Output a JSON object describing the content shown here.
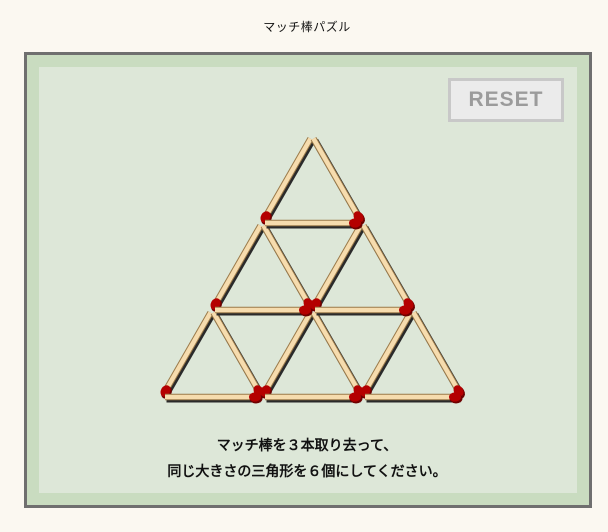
{
  "page": {
    "title": "マッチ棒パズル"
  },
  "controls": {
    "reset_label": "RESET"
  },
  "instructions": {
    "line1": "マッチ棒を３本取り去って、",
    "line2": "同じ大きさの三角形を６個にしてください。"
  },
  "puzzle": {
    "rows": 3,
    "matches_to_remove": 3,
    "target_triangles": 6,
    "match_colors": {
      "stick": "#f6dcae",
      "stick_edge": "#9a7a4a",
      "shadow": "#2a2a2a",
      "head": "#b40000",
      "head_dark": "#6e0000"
    }
  }
}
